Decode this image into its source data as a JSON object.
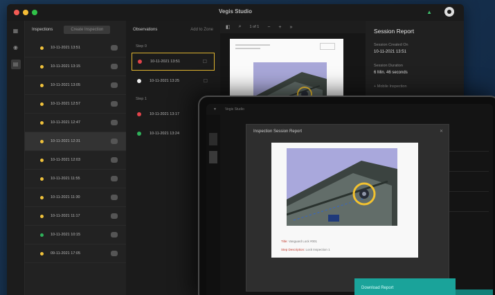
{
  "app": {
    "title": "Vegis Studio",
    "traffic_lights": [
      "#f45b54",
      "#f5bd36",
      "#30c249"
    ]
  },
  "inspections": {
    "tab_label": "Inspections",
    "secondary_tab_label": "Create Inspection",
    "items": [
      {
        "date": "10-11-2021 13:51",
        "status_color": "#f0c23b"
      },
      {
        "date": "10-11-2021 13:15",
        "status_color": "#f0c23b"
      },
      {
        "date": "10-11-2021 13:05",
        "status_color": "#f0c23b"
      },
      {
        "date": "10-11-2021 12:57",
        "status_color": "#f0c23b"
      },
      {
        "date": "10-11-2021 12:47",
        "status_color": "#f0c23b"
      },
      {
        "date": "10-11-2021 12:31",
        "status_color": "#f0c23b",
        "selected": true
      },
      {
        "date": "10-11-2021 12:03",
        "status_color": "#f0c23b"
      },
      {
        "date": "10-11-2021 11:55",
        "status_color": "#f0c23b"
      },
      {
        "date": "10-11-2021 11:30",
        "status_color": "#f0c23b"
      },
      {
        "date": "10-11-2021 11:17",
        "status_color": "#f0c23b"
      },
      {
        "date": "10-11-2021 10:15",
        "status_color": "#2fb25a"
      },
      {
        "date": "09-11-2021 17:05",
        "status_color": "#f0c23b"
      }
    ]
  },
  "observations": {
    "title": "Observations",
    "action_label": "Add to Zone",
    "groups": [
      {
        "label": "Step 0",
        "items": [
          {
            "date": "10-11-2021 13:51",
            "color": "#e2434b",
            "highlight": true
          },
          {
            "date": "10-11-2021 13:25",
            "color": "#eeeeee"
          }
        ]
      },
      {
        "label": "Step 1",
        "items": [
          {
            "date": "10-11-2021 13:17",
            "color": "#e2434b"
          },
          {
            "date": "10-11-2021 13:24",
            "color": "#2fb25a"
          }
        ]
      }
    ]
  },
  "viewer": {
    "page_indicator": "1 of 1"
  },
  "session": {
    "title": "Session Report",
    "created_label": "Session Created On",
    "created_value": "10-11-2021 13:51",
    "duration_label": "Session Duration",
    "duration_value": "6 Min. 46 seconds",
    "more_label": "+ Mobile Inspection"
  },
  "laptop": {
    "app_label": "Vegis Studio",
    "modal_title": "Inspection Session Report",
    "report_line1_key": "Title:",
    "report_line1_value": "Vanguard Lock #001",
    "report_line2_key": "Step Description:",
    "report_line2_value": "Lock Inspection 1",
    "button_label": "Download Report"
  }
}
